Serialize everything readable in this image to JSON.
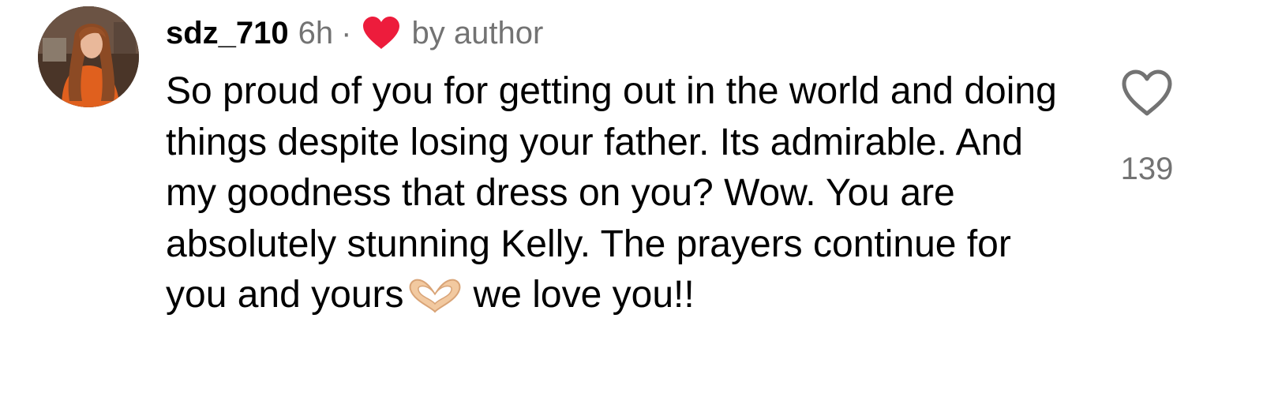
{
  "comment": {
    "username": "sdz_710",
    "time": "6h",
    "separator": "·",
    "liked_by_author_label": "by author",
    "body_before_emoji": "So proud of you for getting out in the world and doing things despite losing your father. Its admirable. And my goodness that dress on you? Wow. You are absolutely stunning Kelly. The prayers continue for you and yours",
    "body_after_emoji": "we love you!!",
    "like_count": "139"
  },
  "icons": {
    "author_heart": "red-heart-icon",
    "emoji": "heart-hands-emoji",
    "like": "heart-outline-icon"
  },
  "colors": {
    "author_heart": "#ed1c3c",
    "secondary_text": "#737373",
    "primary_text": "#000000"
  }
}
